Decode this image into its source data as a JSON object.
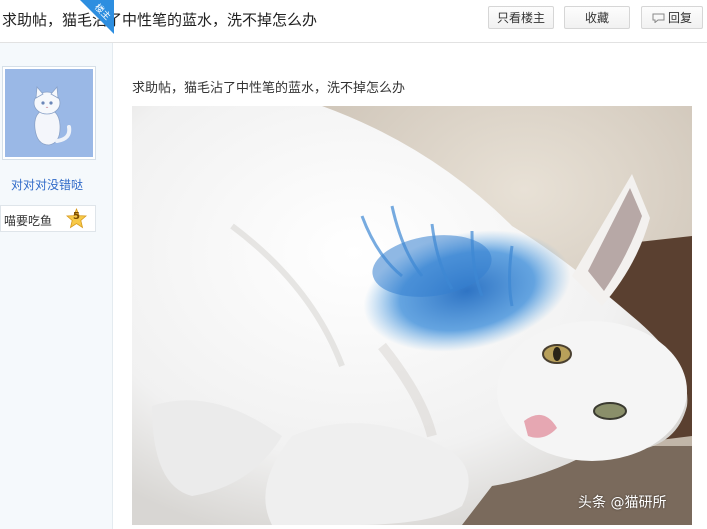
{
  "header": {
    "title": "求助帖，猫毛沾了中性笔的蓝水，洗不掉怎么办",
    "buttons": {
      "only_op": "只看楼主",
      "favorite": "收藏",
      "reply": "回复"
    }
  },
  "author": {
    "badge": "楼主",
    "username": "对对对没错哒",
    "level_name": "喵要吃鱼",
    "level": "5",
    "avatar_icon": "white-cat-avatar"
  },
  "post": {
    "text": "求助帖，猫毛沾了中性笔的蓝水，洗不掉怎么办",
    "image_watermark": "头条 @猫研所"
  },
  "colors": {
    "link": "#2f6ac8",
    "badge": "#2d8ee0",
    "ink_blue": "#3a86d0"
  }
}
